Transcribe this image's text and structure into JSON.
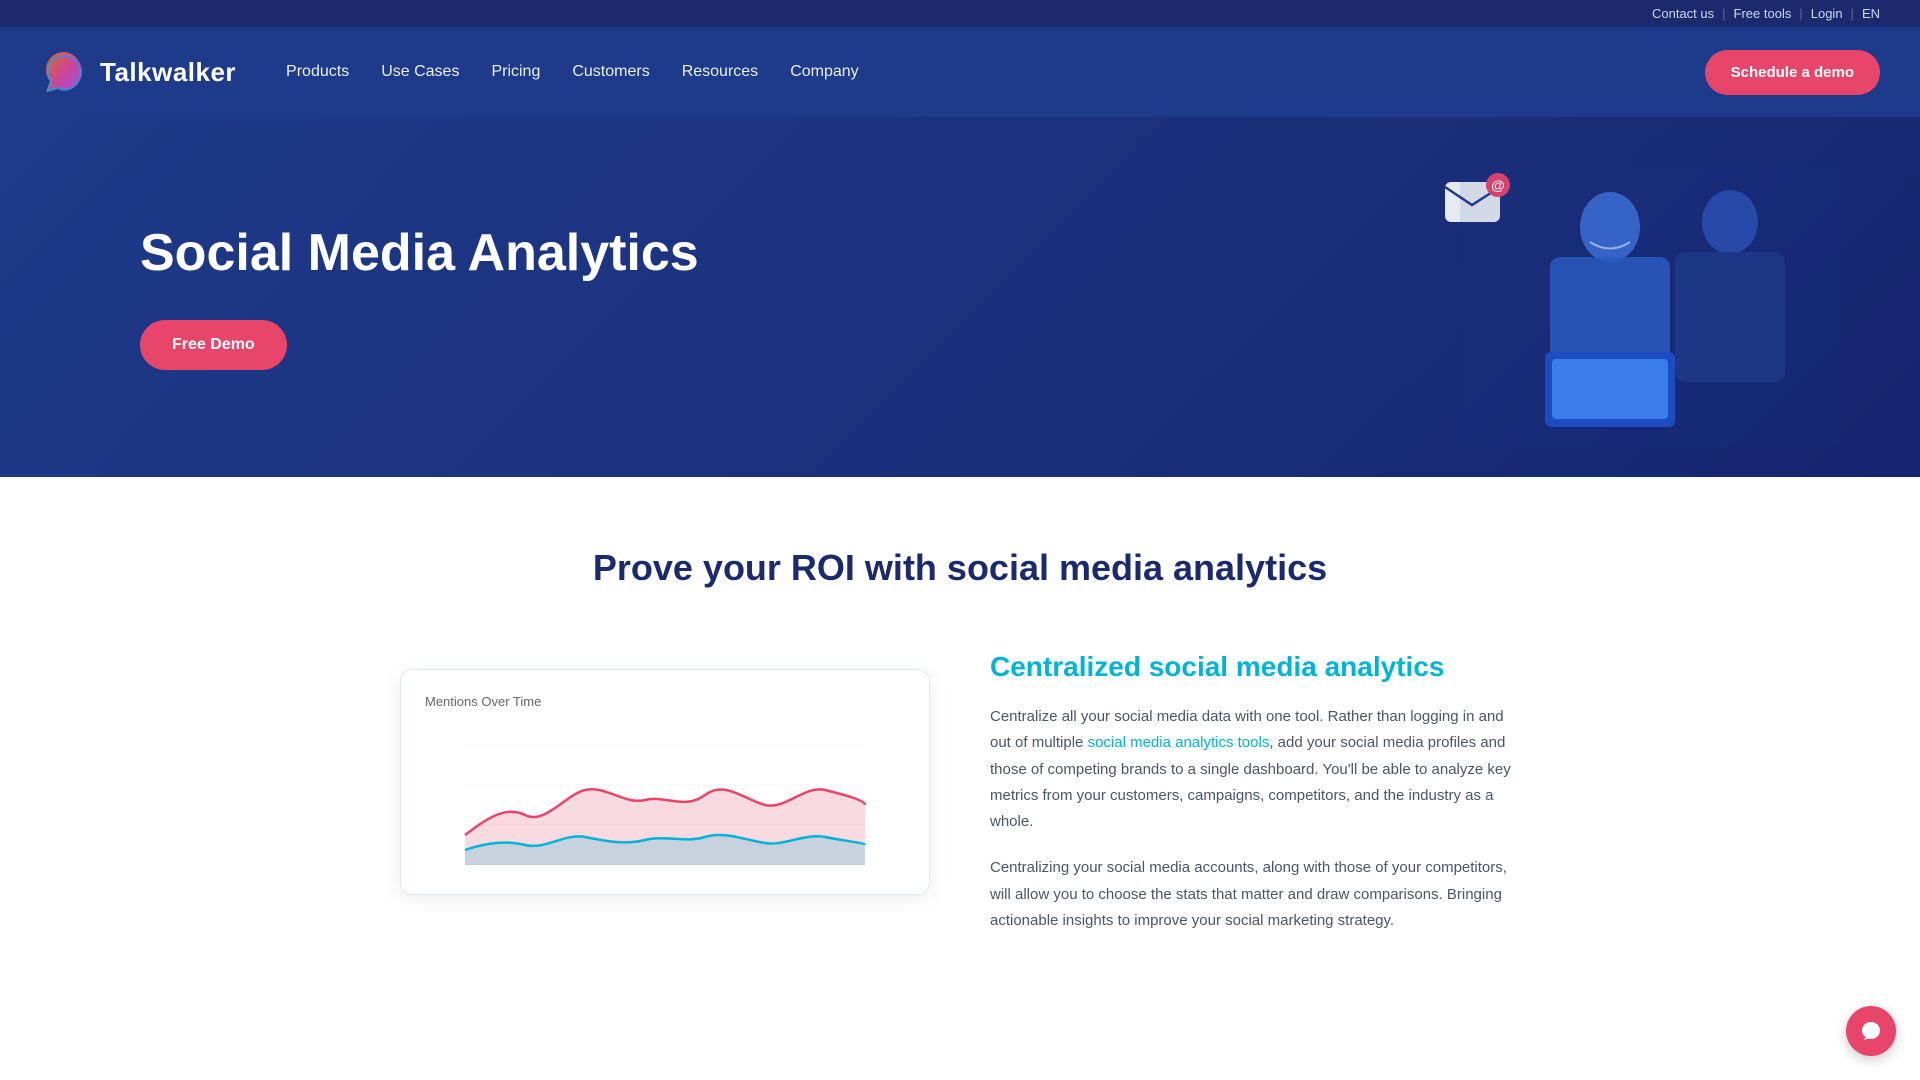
{
  "topbar": {
    "contact_us": "Contact us",
    "free_tools": "Free tools",
    "login": "Login",
    "language": "EN"
  },
  "nav": {
    "logo_text": "Talkwalker",
    "links": [
      {
        "label": "Products",
        "id": "products"
      },
      {
        "label": "Use Cases",
        "id": "use-cases"
      },
      {
        "label": "Pricing",
        "id": "pricing"
      },
      {
        "label": "Customers",
        "id": "customers"
      },
      {
        "label": "Resources",
        "id": "resources"
      },
      {
        "label": "Company",
        "id": "company"
      }
    ],
    "cta_label": "Schedule a demo"
  },
  "hero": {
    "title": "Social Media Analytics",
    "cta_label": "Free Demo"
  },
  "main": {
    "section_title": "Prove your ROI with social media analytics",
    "feature": {
      "title": "Centralized social media analytics",
      "paragraph1_prefix": "Centralize all your social media data with one tool. Rather than logging in and out of multiple ",
      "paragraph1_link": "social media analytics tools",
      "paragraph1_suffix": ", add your social media profiles and those of competing brands to a single dashboard. You'll be able to analyze key metrics from your customers, campaigns, competitors, and the industry as a whole.",
      "paragraph2": "Centralizing your social media accounts, along with those of your competitors, will allow you to choose the stats that matter and draw comparisons. Bringing actionable insights to improve your social marketing strategy."
    },
    "chart": {
      "label": "Mentions Over Time",
      "colors": {
        "pink": "#e8456a",
        "blue": "#00b4d8"
      }
    }
  }
}
